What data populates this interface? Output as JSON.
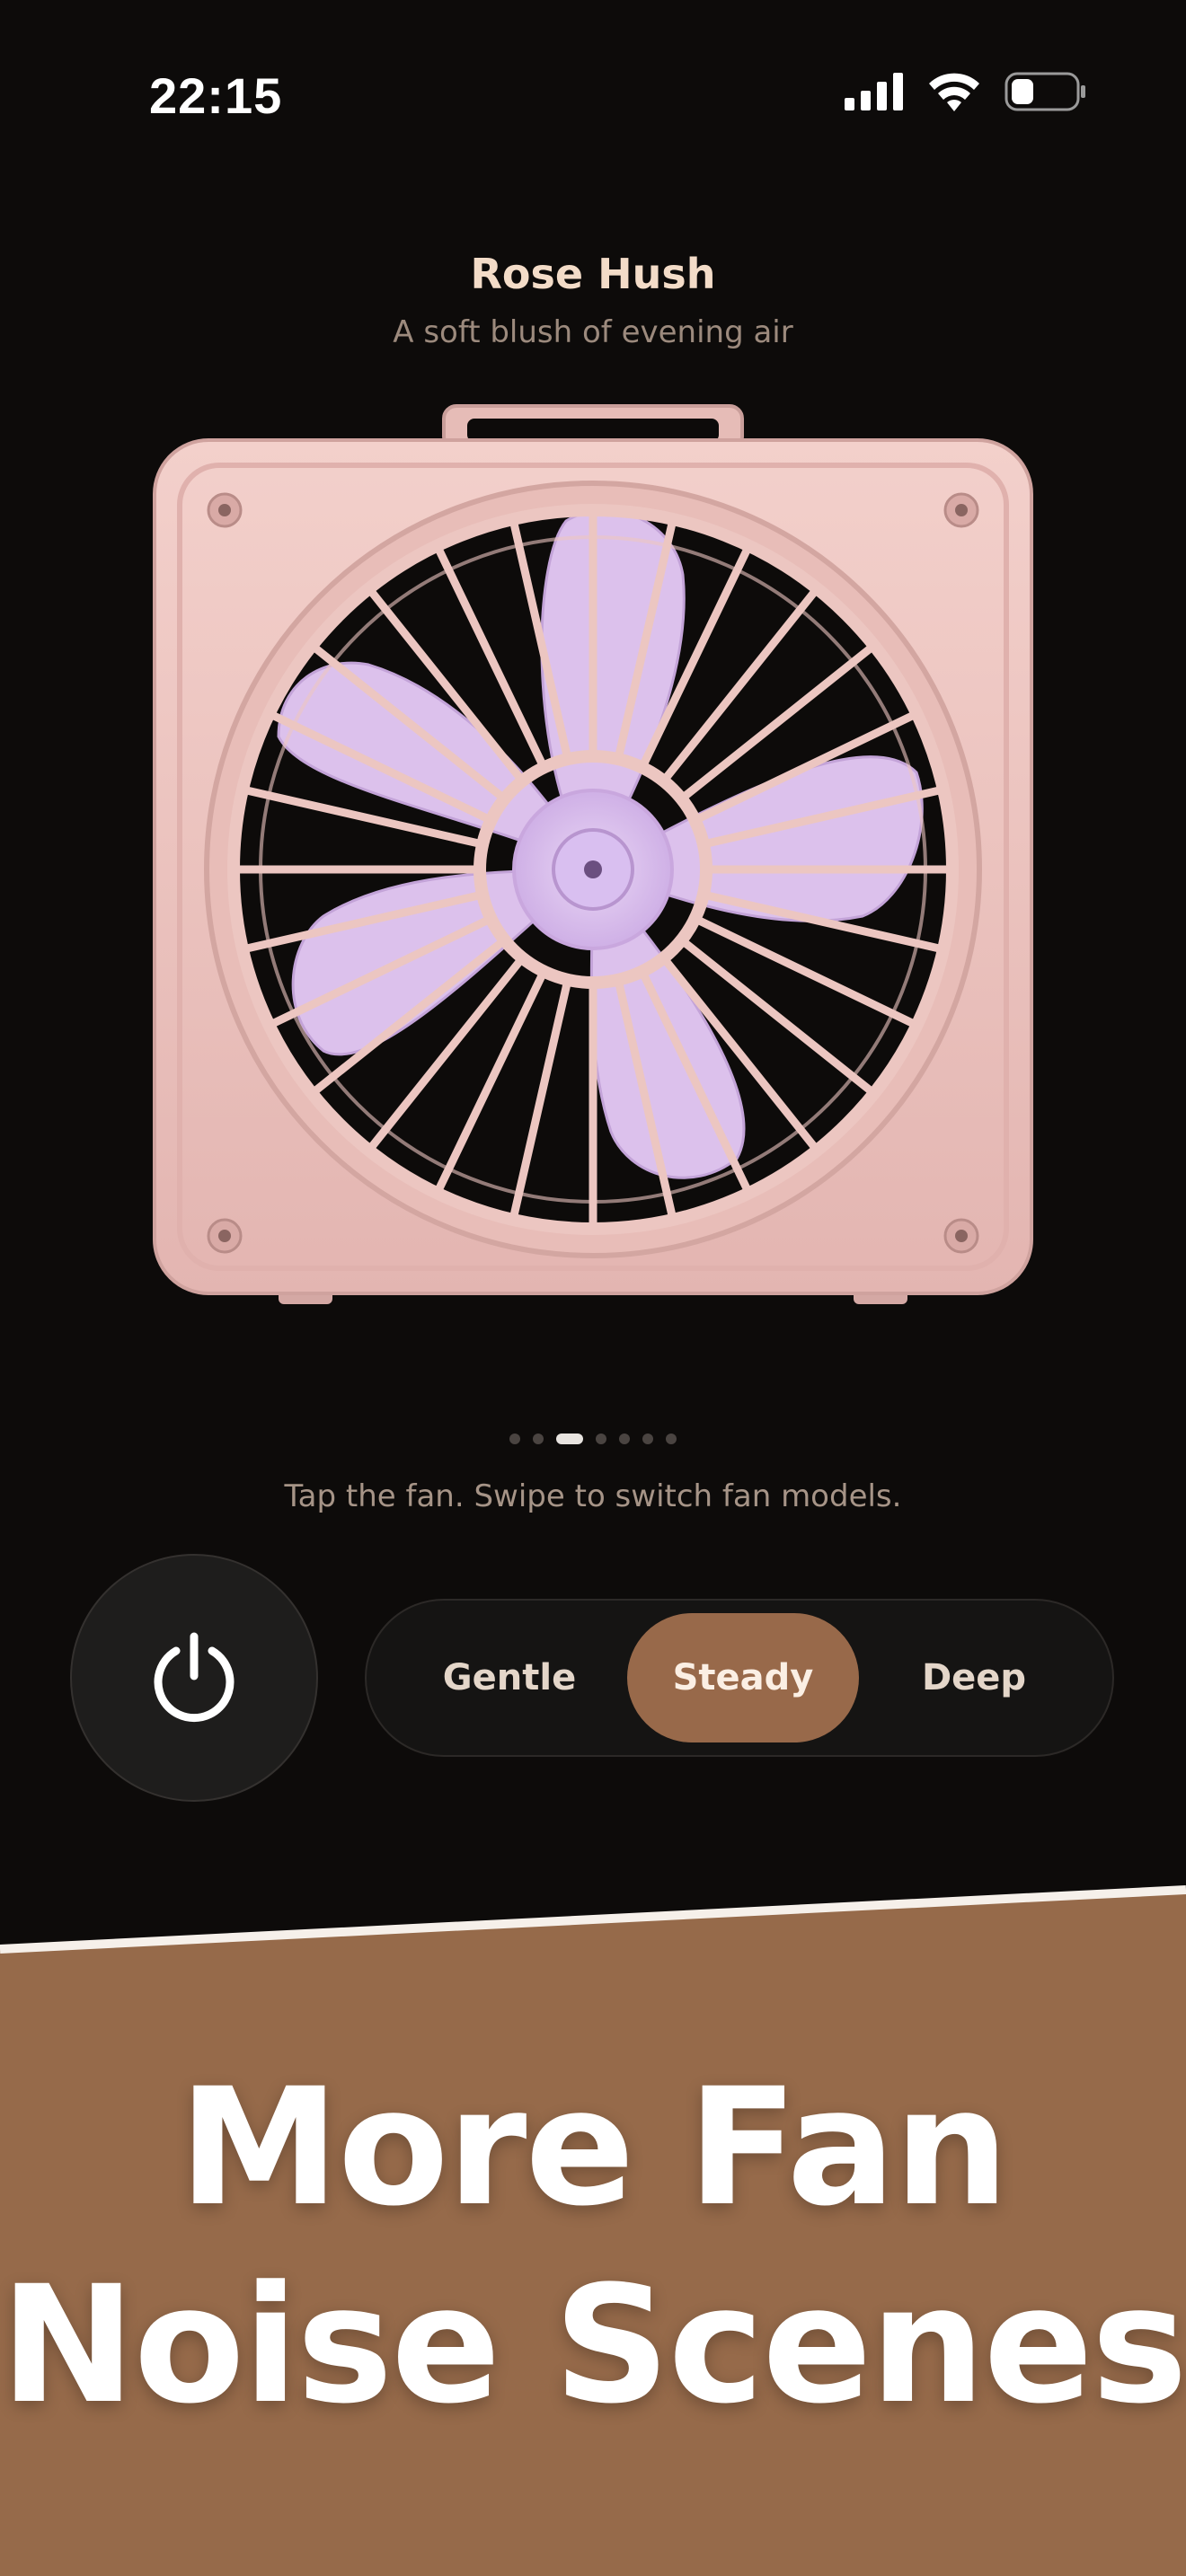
{
  "status_bar": {
    "time": "22:15",
    "icons": [
      "cellular-signal-icon",
      "wifi-icon",
      "battery-icon"
    ],
    "battery_level": 0.35
  },
  "scene": {
    "title": "Rose Hush",
    "subtitle": "A soft blush of evening air",
    "fan_image": "pink-box-fan-with-lavender-blades",
    "page_count": 7,
    "active_page": 3
  },
  "hint": "Tap the fan. Swipe to switch fan models.",
  "controls": {
    "power_icon": "power-icon",
    "speeds": [
      "Gentle",
      "Steady",
      "Deep"
    ],
    "selected_speed": "Steady"
  },
  "banner": {
    "line1": "More Fan",
    "line2": "Noise Scenes",
    "background": "#966a4a"
  },
  "colors": {
    "background": "#0d0b0a",
    "accent": "#98694a",
    "title": "#f3dcc8",
    "fan_body": "#efc7c3",
    "fan_blades": "#dcc1ec"
  }
}
